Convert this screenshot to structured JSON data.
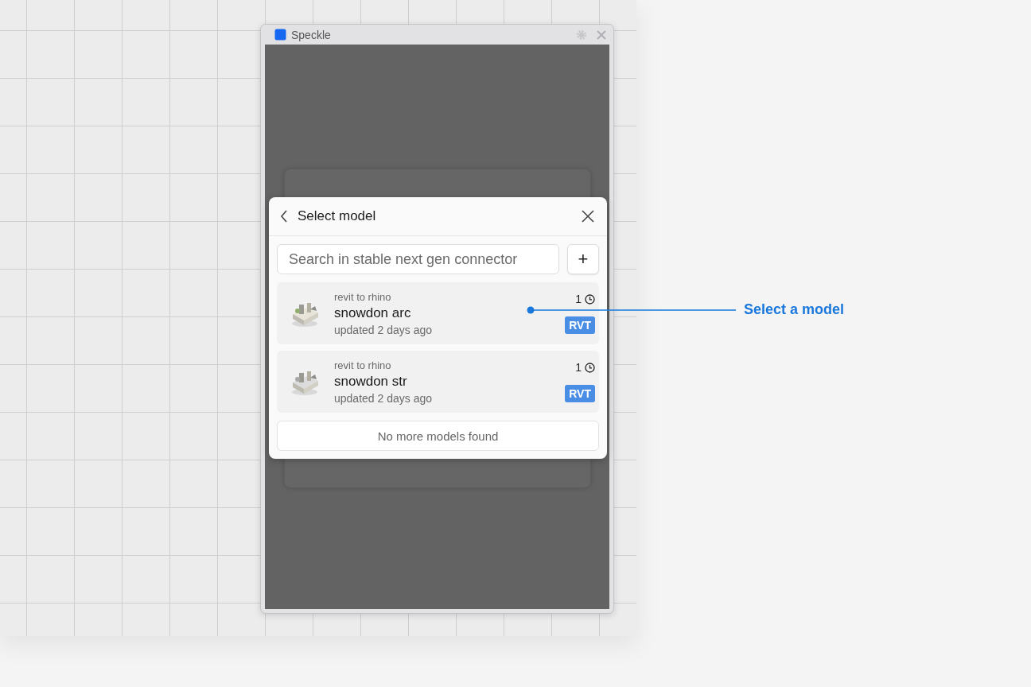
{
  "window": {
    "title": "Speckle"
  },
  "dialog": {
    "title": "Select model",
    "search": {
      "placeholder": "Search in stable next gen connector"
    },
    "add_button": "+",
    "models": [
      {
        "project": "revit to rhino",
        "name": "snowdon arc",
        "updated": "updated 2 days ago",
        "versions": "1",
        "badge": "RVT"
      },
      {
        "project": "revit to rhino",
        "name": "snowdon str",
        "updated": "updated 2 days ago",
        "versions": "1",
        "badge": "RVT"
      }
    ],
    "footer": "No more models found"
  },
  "callout": {
    "label": "Select a model"
  }
}
